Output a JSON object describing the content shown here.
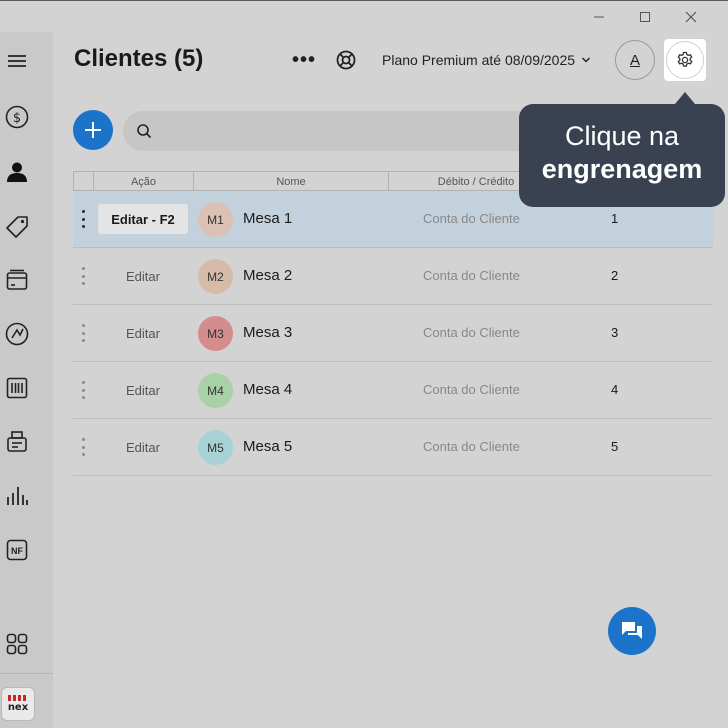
{
  "window": {
    "minimize_glyph": "—",
    "maximize_glyph": "☐",
    "close_glyph": "✕"
  },
  "sidebar": {
    "items": [
      {
        "icon": "menu-icon"
      },
      {
        "icon": "dollar-icon"
      },
      {
        "icon": "user-icon",
        "active": true
      },
      {
        "icon": "tag-icon"
      },
      {
        "icon": "box-icon"
      },
      {
        "icon": "chart-circle-icon"
      },
      {
        "icon": "barcode-icon"
      },
      {
        "icon": "printer-icon"
      },
      {
        "icon": "bar-chart-icon"
      },
      {
        "icon": "nf-icon",
        "label": "NF"
      },
      {
        "icon": "apps-grid-icon"
      }
    ],
    "logo_text": "nex"
  },
  "header": {
    "title": "Clientes (5)",
    "more_label": "•••",
    "plan_label": "Plano Premium até 08/09/2025",
    "user_initial": "A"
  },
  "search": {
    "placeholder": ""
  },
  "tooltip": {
    "line1": "Clique na",
    "line2": "engrenagem"
  },
  "table": {
    "columns": [
      "Ação",
      "Nome",
      "Débito / Crédito"
    ],
    "rows": [
      {
        "edit": "Editar - F2",
        "initials": "M1",
        "name": "Mesa 1",
        "account": "Conta do Cliente",
        "number": "1",
        "badge_color": "#d9c2b3",
        "selected": true
      },
      {
        "edit": "Editar",
        "initials": "M2",
        "name": "Mesa 2",
        "account": "Conta do Cliente",
        "number": "2",
        "badge_color": "#d6bba8"
      },
      {
        "edit": "Editar",
        "initials": "M3",
        "name": "Mesa 3",
        "account": "Conta do Cliente",
        "number": "3",
        "badge_color": "#d58c8c"
      },
      {
        "edit": "Editar",
        "initials": "M4",
        "name": "Mesa 4",
        "account": "Conta do Cliente",
        "number": "4",
        "badge_color": "#a9d1a6"
      },
      {
        "edit": "Editar",
        "initials": "M5",
        "name": "Mesa 5",
        "account": "Conta do Cliente",
        "number": "5",
        "badge_color": "#a9d2d6"
      }
    ]
  },
  "colors": {
    "accent": "#1b74c9",
    "tooltip_bg": "#3a4150",
    "selected_row": "#c3d1dc",
    "background": "#d3d3d3"
  }
}
